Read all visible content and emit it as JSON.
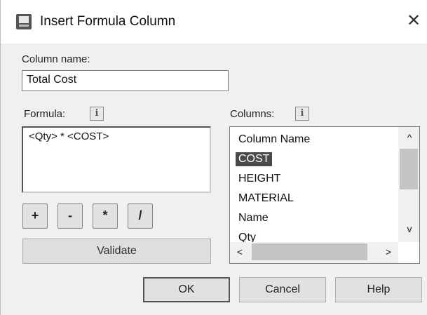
{
  "window": {
    "title": "Insert Formula Column",
    "close_symbol": "✕",
    "icon": "app-icon"
  },
  "column_name": {
    "label": "Column name:",
    "value": "Total Cost"
  },
  "formula": {
    "label": "Formula:",
    "info_symbol": "i",
    "value": "<Qty> * <COST>",
    "operators": [
      "+",
      "-",
      "*",
      "/"
    ],
    "validate_label": "Validate"
  },
  "columns": {
    "label": "Columns:",
    "info_symbol": "i",
    "items": [
      "Column Name",
      "COST",
      "HEIGHT",
      "MATERIAL",
      "Name",
      "Qty"
    ],
    "selected": "COST",
    "scroll_up": "^",
    "scroll_down": "v",
    "scroll_left": "<",
    "scroll_right": ">"
  },
  "buttons": {
    "ok": "OK",
    "cancel": "Cancel",
    "help": "Help"
  }
}
